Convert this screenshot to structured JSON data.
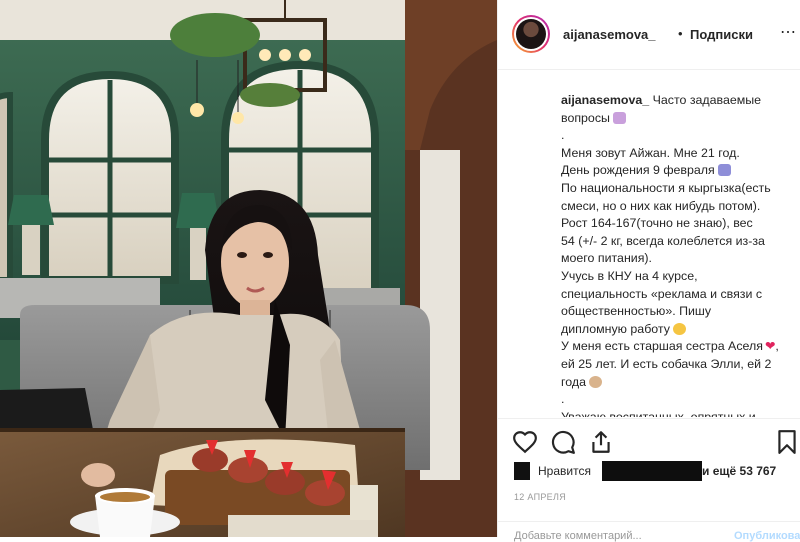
{
  "header": {
    "username": "aijanasemova_",
    "separator": "•",
    "follow_label": "Подписки",
    "more_icon": "more-icon"
  },
  "caption": {
    "username": "aijanasemova_",
    "lines": [
      "Часто задаваемые",
      "вопросы",
      ".",
      "Меня зовут Айжан. Мне 21 год.",
      "День рождения 9 февраля",
      "По национальности я кыргызка(есть",
      "смеси, но о них как нибудь потом).",
      "Рост 164-167(точно не знаю), вес",
      "54 (+/- 2 кг, всегда колеблется из-за",
      "моего питания).",
      "Учусь в КНУ на 4 курсе,",
      "специальность «реклама и связи с",
      "общественностью». Пишу",
      "дипломную работу",
      "У меня есть старшая сестра Аселя",
      "ей 25 лет. И есть собачка Элли, ей 2",
      "года",
      ".",
      "Уважаю воспитанных, опрятных и"
    ]
  },
  "actions": {
    "like_icon": "heart-icon",
    "comment_icon": "comment-icon",
    "share_icon": "share-icon",
    "save_icon": "bookmark-icon"
  },
  "likes": {
    "label": "Нравится",
    "suffix_label": "и ещё",
    "count": "53 767"
  },
  "date": "12 АПРЕЛЯ",
  "comment": {
    "placeholder": "Добавьте комментарий...",
    "publish_label": "Опубликовать"
  },
  "colors": {
    "accent": "#3897f0",
    "wall_green": "#2f5a44",
    "text": "#262626",
    "muted": "#999999"
  }
}
